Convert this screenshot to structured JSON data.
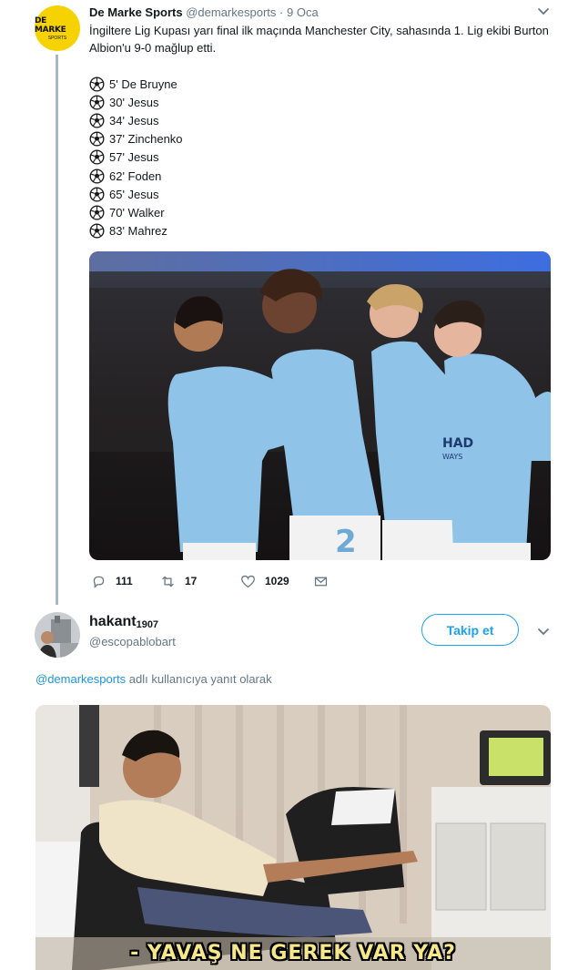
{
  "tweet": {
    "author_name": "De Marke Sports",
    "author_handle": "@demarkesports",
    "separator": "·",
    "date": "9 Oca",
    "avatar_text": "DE MARKE",
    "avatar_subtext": "SPORTS",
    "text": "İngiltere Lig Kupası yarı final ilk maçında Manchester City, sahasında 1. Lig ekibi Burton Albion'u 9-0 mağlup etti.",
    "goals": [
      "5' De Bruyne",
      "30' Jesus",
      "34' Jesus",
      "37' Zinchenko",
      "57' Jesus",
      "62' Foden",
      "65' Jesus",
      "70' Walker",
      "83' Mahrez"
    ],
    "goal_icon": "soccer-ball-icon",
    "photo_jersey_text": "HAD\nWAYS",
    "photo_number": "2",
    "replies": "111",
    "retweets": "17",
    "likes": "1029"
  },
  "reply": {
    "author_name": "hakant",
    "author_suffix": "1907",
    "author_handle": "@escopablobart",
    "follow_label": "Takip et",
    "reply_to_handle": "@demarkesports",
    "reply_to_text": " adlı kullanıcıya yanıt olarak",
    "caption": "- YAVAŞ NE GEREK VAR YA?"
  },
  "colors": {
    "accent": "#1da1f2",
    "link": "#1b95e0",
    "muted": "#657786",
    "avatar_yellow": "#f5d200",
    "city_blue": "#8fc3e8"
  }
}
